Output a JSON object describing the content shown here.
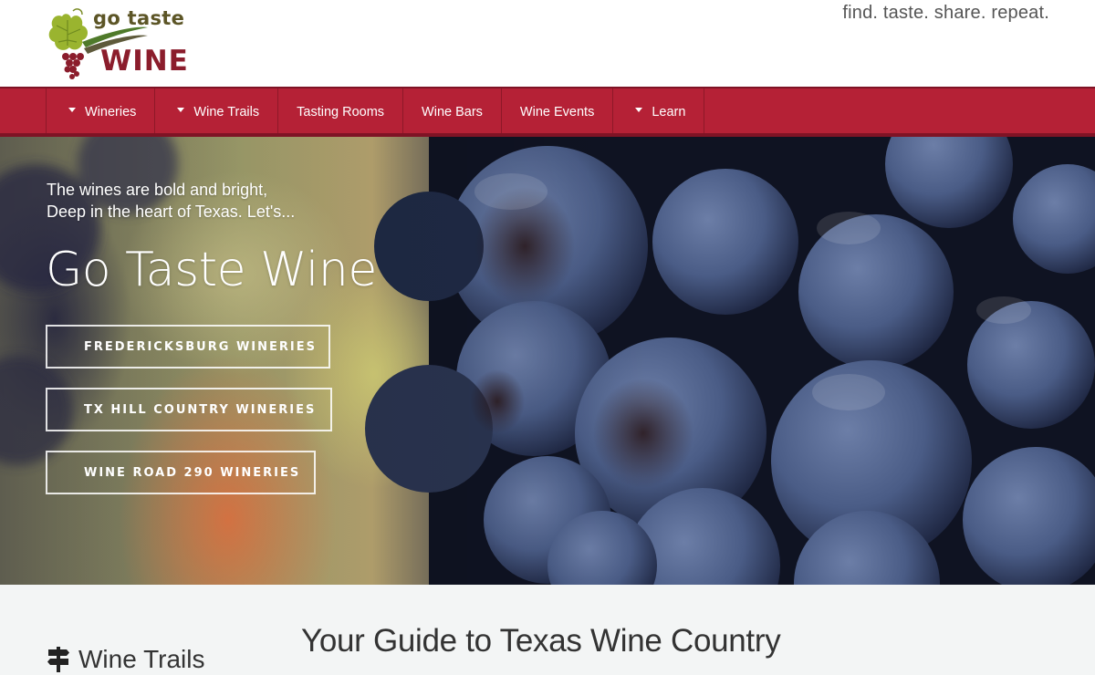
{
  "header": {
    "logo_top": "go taste",
    "logo_bottom": "WINE",
    "tagline": "find. taste. share. repeat."
  },
  "nav": {
    "items": [
      {
        "label": "Wineries",
        "has_caret": true
      },
      {
        "label": "Wine Trails",
        "has_caret": true
      },
      {
        "label": "Tasting Rooms",
        "has_caret": false
      },
      {
        "label": "Wine Bars",
        "has_caret": false
      },
      {
        "label": "Wine Events",
        "has_caret": false
      },
      {
        "label": "Learn",
        "has_caret": true
      }
    ]
  },
  "hero": {
    "intro_line1": "The wines are bold and bright,",
    "intro_line2": "Deep in the heart of Texas. Let's...",
    "title": "Go Taste Wine",
    "buttons": [
      {
        "label": "FREDERICKSBURG WINERIES"
      },
      {
        "label": "TX HILL COUNTRY WINERIES"
      },
      {
        "label": "WINE ROAD 290 WINERIES"
      }
    ]
  },
  "section": {
    "sidebar_heading": "Wine Trails",
    "sidebar_icon": "signpost-icon",
    "main_heading": "Your Guide to Texas Wine Country"
  },
  "colors": {
    "brand_red": "#b52136",
    "brand_dark_red": "#7f1325",
    "logo_green": "#8aa32a"
  }
}
